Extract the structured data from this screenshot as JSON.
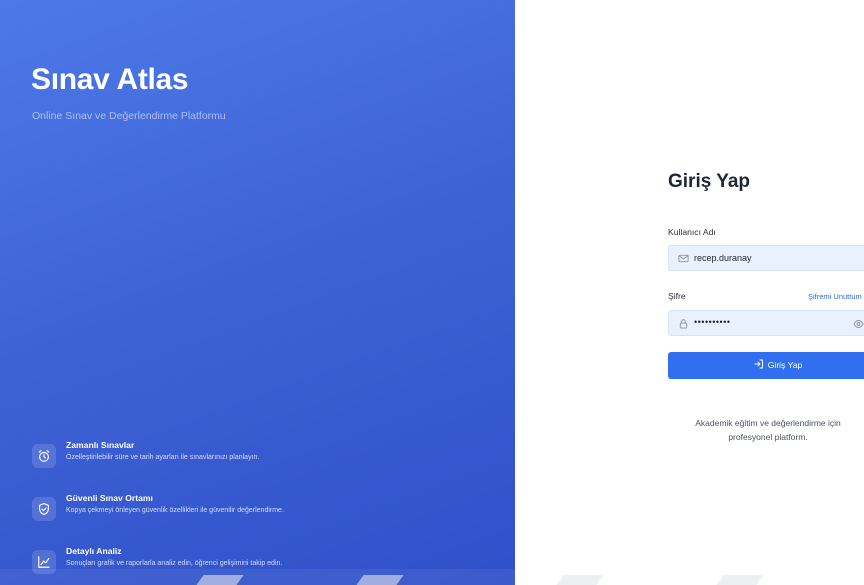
{
  "brand": {
    "title": "Sınav Atlas",
    "subtitle": "Online Sınav ve Değerlendirme Platformu"
  },
  "features": [
    {
      "icon": "alarm-clock-icon",
      "title": "Zamanlı Sınavlar",
      "description": "Özelleştirilebilir süre ve tarih ayarları ile sınavlarınızı planlayın."
    },
    {
      "icon": "shield-check-icon",
      "title": "Güvenli Sınav Ortamı",
      "description": "Kopya çekmeyi önleyen güvenlik özellikleri ile güvenilir değerlendirme."
    },
    {
      "icon": "line-chart-icon",
      "title": "Detaylı Analiz",
      "description": "Sonuçları grafik ve raporlarla analiz edin, öğrenci gelişimini takip edin."
    }
  ],
  "login": {
    "title": "Giriş Yap",
    "username_label": "Kullanıcı Adı",
    "username_value": "recep.duranay",
    "password_label": "Şifre",
    "password_value": "••••••••••",
    "forgot_link": "Şifremi Unuttum",
    "submit_label": "Giriş Yap",
    "footer_line1": "Akademik eğitim ve değerlendirme için",
    "footer_line2": "profesyonel platform."
  },
  "colors": {
    "accent": "#2f6ff0",
    "panel_gradient_start": "#4d79e8",
    "panel_gradient_end": "#3050c9",
    "input_bg": "#e9f0fe"
  }
}
